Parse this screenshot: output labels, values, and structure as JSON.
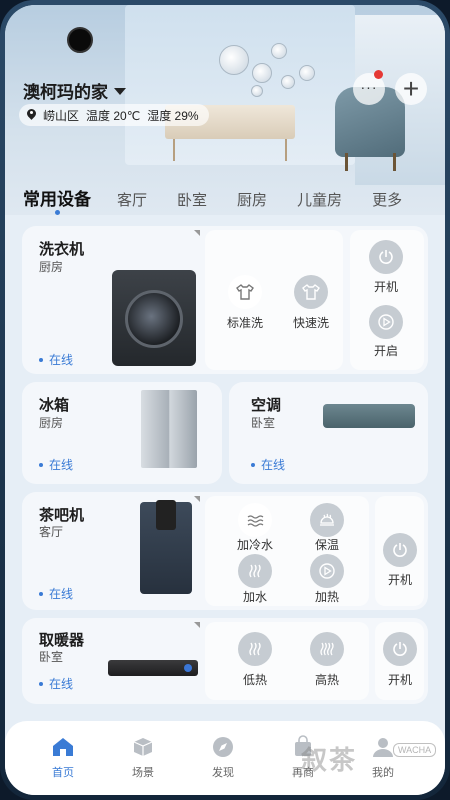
{
  "header": {
    "home_name": "澳柯玛的家",
    "location": "崂山区",
    "temperature": "温度 20℃",
    "humidity": "湿度 29%",
    "add_symbol": "+",
    "more_symbol": "···"
  },
  "tabs": [
    "常用设备",
    "客厅",
    "卧室",
    "厨房",
    "儿童房",
    "更多"
  ],
  "devices": {
    "washer": {
      "name": "洗衣机",
      "room": "厨房",
      "status": "在线",
      "mode_1": "标准洗",
      "mode_2": "快速洗",
      "power": "开机",
      "start": "开启"
    },
    "fridge": {
      "name": "冰箱",
      "room": "厨房",
      "status": "在线"
    },
    "ac": {
      "name": "空调",
      "room": "卧室",
      "status": "在线"
    },
    "teabar": {
      "name": "茶吧机",
      "room": "客厅",
      "status": "在线",
      "mode_1": "加冷水",
      "mode_2": "保温",
      "mode_3": "加水",
      "mode_4": "加热",
      "power": "开机"
    },
    "heater": {
      "name": "取暖器",
      "room": "卧室",
      "status": "在线",
      "mode_1": "低热",
      "mode_2": "高热",
      "power": "开机"
    }
  },
  "bottom_nav": [
    "首页",
    "场景",
    "发现",
    "再商",
    "我的"
  ],
  "watermark": {
    "text": "叙茶",
    "tag": "WACHA"
  },
  "colors": {
    "accent": "#3a7bd5",
    "alert": "#e53935"
  }
}
